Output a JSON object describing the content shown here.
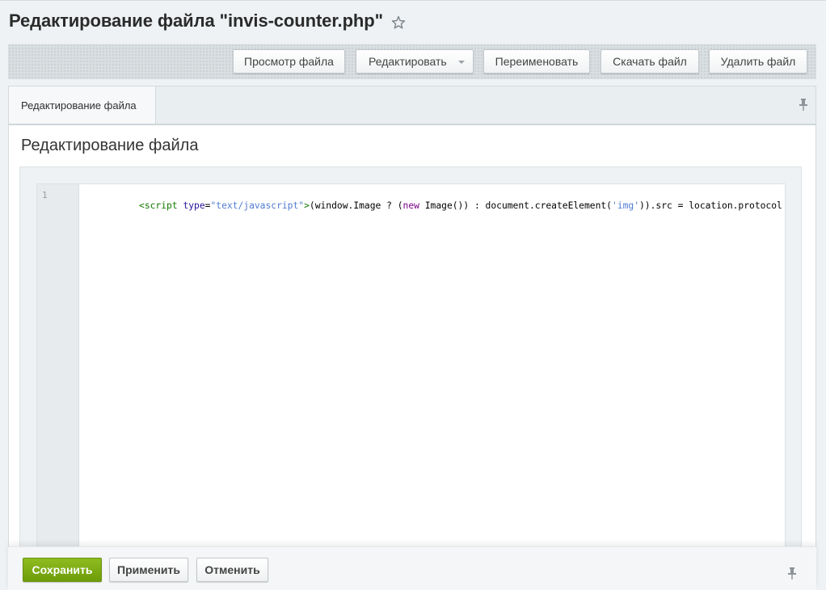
{
  "page": {
    "title": "Редактирование файла \"invis-counter.php\"",
    "favorite_icon": "star-icon"
  },
  "toolbar": {
    "view_label": "Просмотр файла",
    "edit_label": "Редактировать",
    "rename_label": "Переименовать",
    "download_label": "Скачать файл",
    "delete_label": "Удалить файл"
  },
  "tabs": {
    "active_label": "Редактирование файла",
    "pin_icon": "pin-icon"
  },
  "panel": {
    "section_title": "Редактирование файла"
  },
  "editor": {
    "lines": [
      {
        "number": "1",
        "tokens": [
          {
            "type": "tag",
            "text": "<script"
          },
          {
            "type": "plain",
            "text": " "
          },
          {
            "type": "attr",
            "text": "type"
          },
          {
            "type": "plain",
            "text": "="
          },
          {
            "type": "str",
            "text": "\"text/javascript\""
          },
          {
            "type": "tag",
            "text": ">"
          },
          {
            "type": "plain",
            "text": "(window.Image ? ("
          },
          {
            "type": "kw",
            "text": "new"
          },
          {
            "type": "plain",
            "text": " Image()) : document.createElement("
          },
          {
            "type": "str",
            "text": "'img'"
          },
          {
            "type": "plain",
            "text": ")).src = location.protocol + "
          },
          {
            "type": "str",
            "text": "'/"
          }
        ]
      }
    ]
  },
  "actions": {
    "save_label": "Сохранить",
    "apply_label": "Применить",
    "cancel_label": "Отменить"
  },
  "colors": {
    "save_button": "#7aab10",
    "string_token": "#4f7bd1",
    "tag_token": "#117700",
    "keyword_token": "#770088"
  }
}
